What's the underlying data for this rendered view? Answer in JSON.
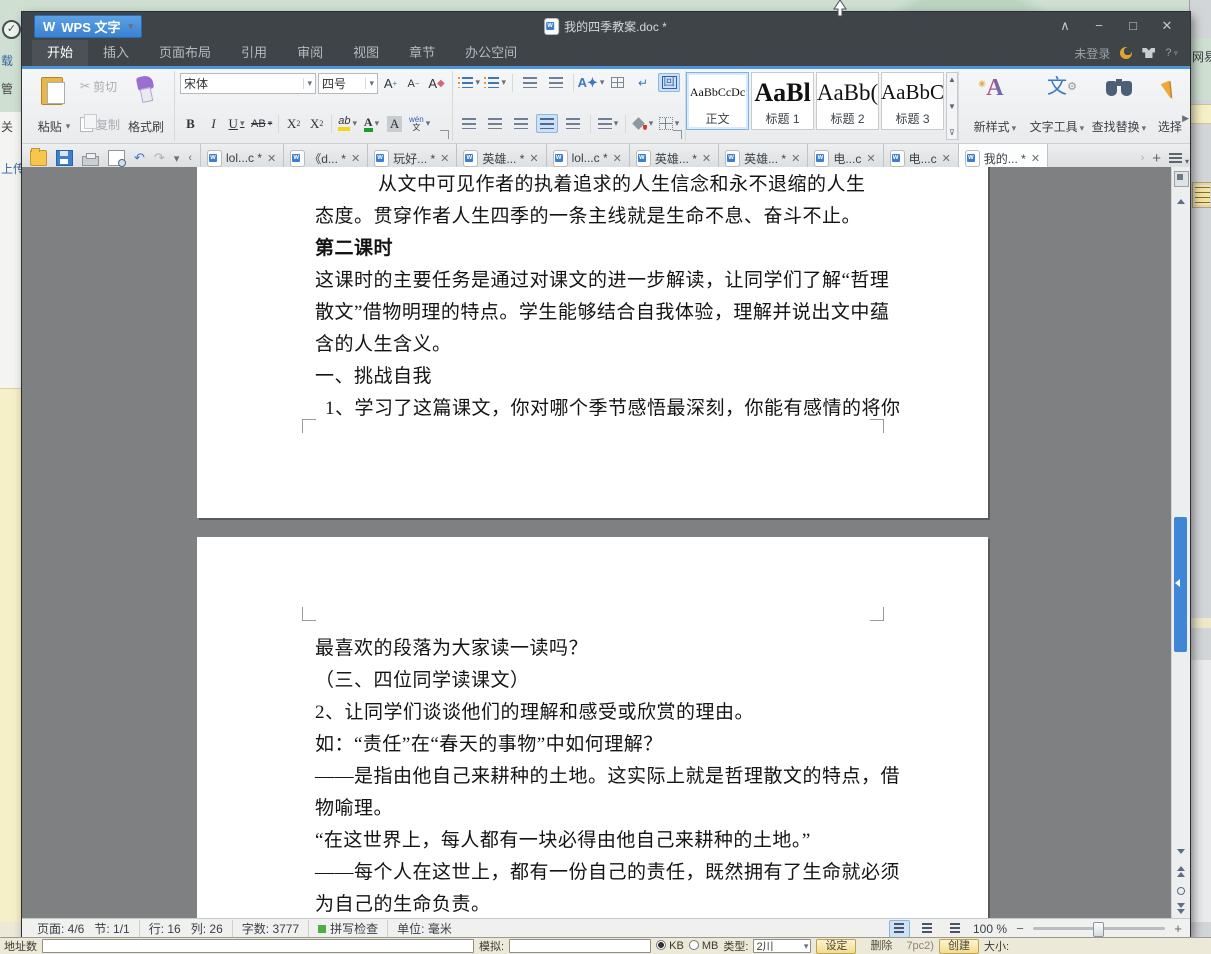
{
  "window": {
    "app_button": "WPS 文字",
    "app_logo": "W",
    "doc_title": "我的四季教案.doc *",
    "login": "未登录",
    "help": "?",
    "controls": {
      "collapse": "∧",
      "minimize": "−",
      "maximize": "□",
      "close": "✕"
    }
  },
  "menu": {
    "tabs": [
      "开始",
      "插入",
      "页面布局",
      "引用",
      "审阅",
      "视图",
      "章节",
      "办公空间"
    ]
  },
  "ribbon": {
    "clipboard": {
      "paste": "粘贴",
      "cut": "剪切",
      "copy": "复制",
      "format_painter": "格式刷"
    },
    "font": {
      "family": "宋体",
      "size": "四号",
      "grow": "A",
      "shrink": "A",
      "clear": "A",
      "bold": "B",
      "italic": "I",
      "underline": "U",
      "strike": "AB",
      "sup_base": "X",
      "sup_mark": "2",
      "sub_base": "X",
      "sub_mark": "2",
      "highlight": "ab",
      "color": "A",
      "shading": "A",
      "pinyin_top": "wén",
      "pinyin_bottom": "文"
    },
    "styles": [
      {
        "preview": "AaBbCcDc",
        "label": "正文"
      },
      {
        "preview": "AaBl",
        "label": "标题 1"
      },
      {
        "preview": "AaBb(",
        "label": "标题 2"
      },
      {
        "preview": "AaBbC",
        "label": "标题 3"
      }
    ],
    "tools": {
      "new_style": "新样式",
      "text_tool": "文字工具",
      "find_replace": "查找替换",
      "select": "选择"
    }
  },
  "doc_tabs": [
    "lol...c *",
    "《d... *",
    "玩好... *",
    "英雄... *",
    "lol...c *",
    "英雄... *",
    "英雄... *",
    "电...c",
    "电...c",
    "我的... *"
  ],
  "document": {
    "page1_lines": [
      "从文中可见作者的执着追求的人生信念和永不退缩的人生",
      "态度。贯穿作者人生四季的一条主线就是生命不息、奋斗不止。",
      "第二课时",
      "这课时的主要任务是通过对课文的进一步解读，让同学们了解“哲理",
      "散文”借物明理的特点。学生能够结合自我体验，理解并说出文中蕴",
      "含的人生含义。",
      "一、挑战自我",
      "1、学习了这篇课文，你对哪个季节感悟最深刻，你能有感情的将你"
    ],
    "page2_lines": [
      "最喜欢的段落为大家读一读吗？",
      "（三、四位同学读课文）",
      "2、让同学们谈谈他们的理解和感受或欣赏的理由。",
      "如：“责任”在“春天的事物”中如何理解？",
      "——是指由他自己来耕种的土地。这实际上就是哲理散文的特点，借",
      "物喻理。",
      "“在这世界上，每人都有一块必得由他自己来耕种的土地。”",
      "——每个人在这世上，都有一份自己的责任，既然拥有了生命就必须",
      "为自己的生命负责。"
    ]
  },
  "status": {
    "page": "页面: 4/6",
    "section": "节: 1/1",
    "line": "行: 16",
    "column": "列: 26",
    "words": "字数: 3777",
    "spell": "拼写检查",
    "unit": "单位: 毫米",
    "zoom": "100 %",
    "zoom_minus": "−",
    "zoom_plus": "+"
  },
  "colors": {
    "accent_blue": "#4f93da",
    "titlebar": "#3f4448",
    "scroll_thumb": "#3f86d6",
    "spell_green": "#4caf3f",
    "page_bg": "#ffffff",
    "canvas_grey": "#7e8082"
  },
  "background_app": {
    "left_fragments": [
      "载",
      "管",
      "关",
      "上传"
    ],
    "right_fragment": "网易",
    "bottom": {
      "addr_label": "地址数",
      "sim_label": "模拟:",
      "kb": "KB",
      "mb": "MB",
      "type_label": "类型:",
      "type_value": "2川",
      "set_btn": "设定",
      "del_btn": "删除",
      "pc_text": "7pc2)",
      "create_btn": "创建",
      "size_label": "大小:"
    }
  }
}
